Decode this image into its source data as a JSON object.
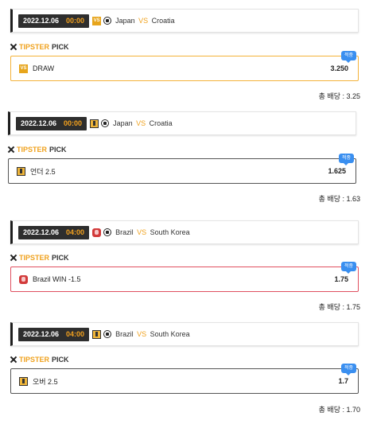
{
  "blocks": [
    {
      "date": "2022.12.06",
      "time": "00:00",
      "home": "Japan",
      "vs": "VS",
      "away": "Croatia",
      "tipster_a": "TIPSTER",
      "tipster_b": "PICK",
      "pick": "DRAW",
      "odds": "3.250",
      "badge": "적중",
      "total": "총 배당 : 3.25"
    },
    {
      "date": "2022.12.06",
      "time": "00:00",
      "home": "Japan",
      "vs": "VS",
      "away": "Croatia",
      "tipster_a": "TIPSTER",
      "tipster_b": "PICK",
      "pick": "언더 2.5",
      "odds": "1.625",
      "badge": "적중",
      "total": "총 배당 : 1.63"
    },
    {
      "date": "2022.12.06",
      "time": "04:00",
      "home": "Brazil",
      "vs": "VS",
      "away": "South Korea",
      "tipster_a": "TIPSTER",
      "tipster_b": "PICK",
      "pick": "Brazil WIN -1.5",
      "odds": "1.75",
      "badge": "적중",
      "total": "총 배당 : 1.75"
    },
    {
      "date": "2022.12.06",
      "time": "04:00",
      "home": "Brazil",
      "vs": "VS",
      "away": "South Korea",
      "tipster_a": "TIPSTER",
      "tipster_b": "PICK",
      "pick": "오버 2.5",
      "odds": "1.7",
      "badge": "적중",
      "total": "총 배당 : 1.70"
    }
  ],
  "icons": {
    "b0_header": "vs-icon",
    "b0_pick": "vs-icon",
    "b1_header": "under-over-icon",
    "b1_pick": "under-over-icon",
    "b2_header": "brazil-team-icon",
    "b2_pick": "brazil-team-icon",
    "b3_header": "under-over-icon",
    "b3_pick": "under-over-icon"
  },
  "colors": {
    "accent": "#f0a21e",
    "badge": "#3a8ff0",
    "gold_border": "#f4b23a",
    "red_border": "#e05060"
  }
}
